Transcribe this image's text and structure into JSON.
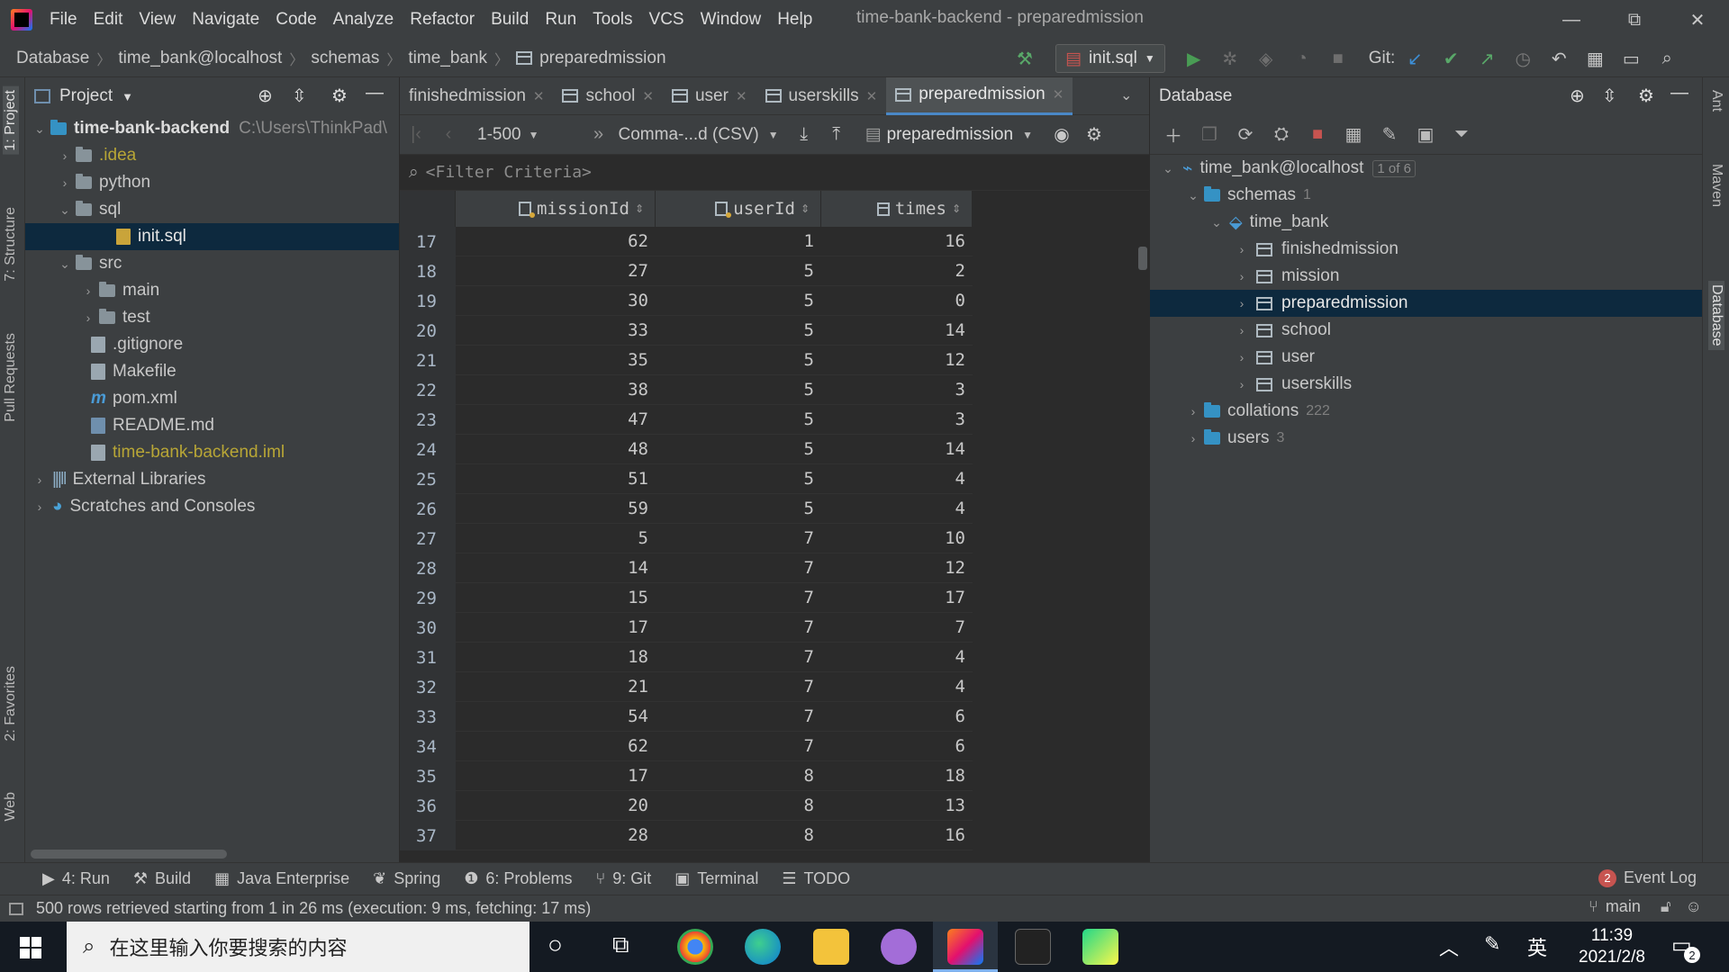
{
  "window": {
    "menu": [
      "File",
      "Edit",
      "View",
      "Navigate",
      "Code",
      "Analyze",
      "Refactor",
      "Build",
      "Run",
      "Tools",
      "VCS",
      "Window",
      "Help"
    ],
    "title": "time-bank-backend - preparedmission",
    "controls": {
      "minimize": "—",
      "restore": "⧉",
      "close": "✕"
    }
  },
  "breadcrumb": [
    "Database",
    "time_bank@localhost",
    "schemas",
    "time_bank",
    "preparedmission"
  ],
  "toolbar": {
    "run_config": "init.sql",
    "git_label": "Git:"
  },
  "left_strip": [
    "1: Project",
    "7: Structure",
    "Pull Requests",
    "2: Favorites",
    "Web"
  ],
  "right_strip": [
    "Ant",
    "Maven",
    "Database"
  ],
  "project": {
    "header": "Project",
    "root": {
      "name": "time-bank-backend",
      "path": "C:\\Users\\ThinkPad\\"
    },
    "items": [
      {
        "label": ".idea",
        "depth": 1
      },
      {
        "label": "python",
        "depth": 1
      },
      {
        "label": "sql",
        "depth": 1
      },
      {
        "label": "init.sql",
        "depth": 2
      },
      {
        "label": "src",
        "depth": 1
      },
      {
        "label": "main",
        "depth": 2
      },
      {
        "label": "test",
        "depth": 2
      },
      {
        "label": ".gitignore",
        "depth": 1
      },
      {
        "label": "Makefile",
        "depth": 1
      },
      {
        "label": "pom.xml",
        "depth": 1
      },
      {
        "label": "README.md",
        "depth": 1
      },
      {
        "label": "time-bank-backend.iml",
        "depth": 1
      },
      {
        "label": "External Libraries",
        "depth": 0
      },
      {
        "label": "Scratches and Consoles",
        "depth": 0
      }
    ]
  },
  "editor_tabs": [
    "finishedmission",
    "school",
    "user",
    "userskills",
    "preparedmission"
  ],
  "grid_toolbar": {
    "page_range": "1-500",
    "export_format": "Comma-...d (CSV)",
    "table_selector": "preparedmission"
  },
  "filter": {
    "placeholder": "<Filter Criteria>"
  },
  "grid": {
    "columns": [
      "missionId",
      "userId",
      "times"
    ],
    "rows": [
      {
        "n": "17",
        "missionId": "62",
        "userId": "1",
        "times": "16"
      },
      {
        "n": "18",
        "missionId": "27",
        "userId": "5",
        "times": "2"
      },
      {
        "n": "19",
        "missionId": "30",
        "userId": "5",
        "times": "0"
      },
      {
        "n": "20",
        "missionId": "33",
        "userId": "5",
        "times": "14"
      },
      {
        "n": "21",
        "missionId": "35",
        "userId": "5",
        "times": "12"
      },
      {
        "n": "22",
        "missionId": "38",
        "userId": "5",
        "times": "3"
      },
      {
        "n": "23",
        "missionId": "47",
        "userId": "5",
        "times": "3"
      },
      {
        "n": "24",
        "missionId": "48",
        "userId": "5",
        "times": "14"
      },
      {
        "n": "25",
        "missionId": "51",
        "userId": "5",
        "times": "4"
      },
      {
        "n": "26",
        "missionId": "59",
        "userId": "5",
        "times": "4"
      },
      {
        "n": "27",
        "missionId": "5",
        "userId": "7",
        "times": "10"
      },
      {
        "n": "28",
        "missionId": "14",
        "userId": "7",
        "times": "12"
      },
      {
        "n": "29",
        "missionId": "15",
        "userId": "7",
        "times": "17"
      },
      {
        "n": "30",
        "missionId": "17",
        "userId": "7",
        "times": "7"
      },
      {
        "n": "31",
        "missionId": "18",
        "userId": "7",
        "times": "4"
      },
      {
        "n": "32",
        "missionId": "21",
        "userId": "7",
        "times": "4"
      },
      {
        "n": "33",
        "missionId": "54",
        "userId": "7",
        "times": "6"
      },
      {
        "n": "34",
        "missionId": "62",
        "userId": "7",
        "times": "6"
      },
      {
        "n": "35",
        "missionId": "17",
        "userId": "8",
        "times": "18"
      },
      {
        "n": "36",
        "missionId": "20",
        "userId": "8",
        "times": "13"
      },
      {
        "n": "37",
        "missionId": "28",
        "userId": "8",
        "times": "16"
      }
    ]
  },
  "database": {
    "header": "Database",
    "connection": {
      "label": "time_bank@localhost",
      "badge": "1 of 6"
    },
    "schemas": {
      "label": "schemas",
      "count": "1"
    },
    "schema": "time_bank",
    "tables": [
      "finishedmission",
      "mission",
      "preparedmission",
      "school",
      "user",
      "userskills"
    ],
    "collations": {
      "label": "collations",
      "count": "222"
    },
    "users": {
      "label": "users",
      "count": "3"
    }
  },
  "bottom_tabs": [
    "4: Run",
    "Build",
    "Java Enterprise",
    "Spring",
    "6: Problems",
    "9: Git",
    "Terminal",
    "TODO"
  ],
  "event_log": {
    "count": "2",
    "label": "Event Log"
  },
  "status": {
    "message": "500 rows retrieved starting from 1 in 26 ms (execution: 9 ms, fetching: 17 ms)",
    "branch": "main"
  },
  "taskbar": {
    "search_placeholder": "在这里输入你要搜索的内容",
    "time": "11:39",
    "date": "2021/2/8",
    "ime": "英",
    "notifications": "2"
  }
}
